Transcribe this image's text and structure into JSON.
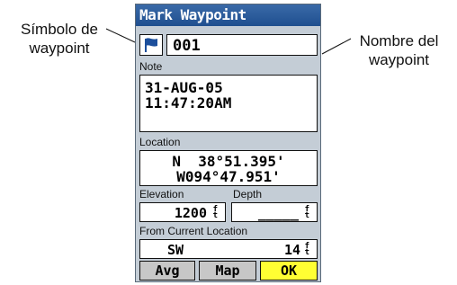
{
  "callouts": {
    "left": [
      "Símbolo de",
      "waypoint"
    ],
    "right": [
      "Nombre del",
      "waypoint"
    ]
  },
  "screen": {
    "title": "Mark Waypoint",
    "symbol_icon": "flag-icon",
    "name_value": "001",
    "note_label": "Note",
    "note_lines": [
      "31-AUG-05",
      "11:47:20AM"
    ],
    "location_label": "Location",
    "location_lines": [
      "N  38°51.395'",
      "W094°47.951'"
    ],
    "elevation_label": "Elevation",
    "elevation_value": "1200",
    "depth_label": "Depth",
    "depth_value": "_____",
    "unit_ft_top": "f",
    "unit_ft_bottom": "t",
    "from_label": "From Current Location",
    "direction_value": "SW",
    "distance_value": "14",
    "buttons": {
      "avg": "Avg",
      "map": "Map",
      "ok": "OK"
    }
  },
  "colors": {
    "title_bar": "#2a5c9c",
    "panel": "#c4cdd6",
    "ok_button": "#ffff33",
    "flag": "#1c4f9c"
  }
}
